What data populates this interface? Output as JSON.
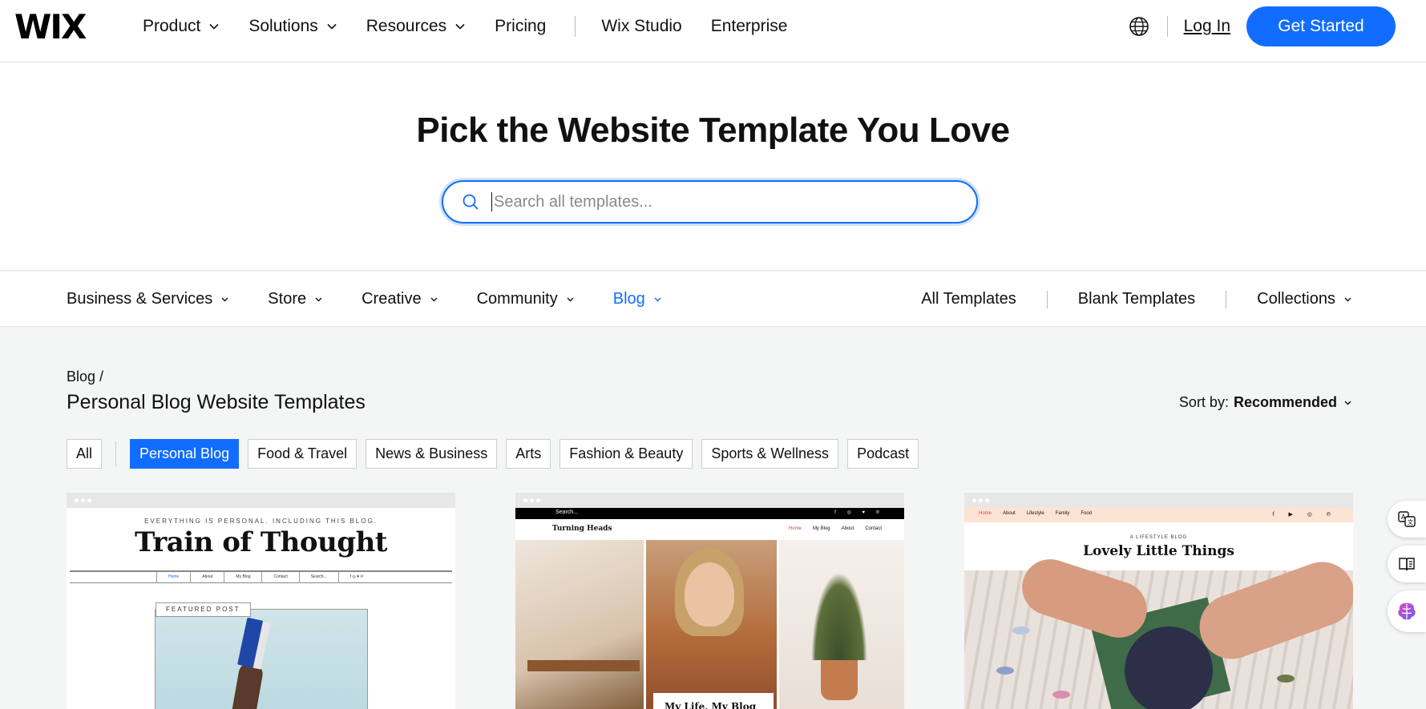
{
  "header": {
    "logo": "WIX",
    "nav": [
      {
        "label": "Product",
        "dropdown": true
      },
      {
        "label": "Solutions",
        "dropdown": true
      },
      {
        "label": "Resources",
        "dropdown": true
      },
      {
        "label": "Pricing",
        "dropdown": false
      }
    ],
    "nav_secondary": [
      {
        "label": "Wix Studio"
      },
      {
        "label": "Enterprise"
      }
    ],
    "login_label": "Log In",
    "cta_label": "Get Started",
    "globe_icon": "globe-icon"
  },
  "hero": {
    "title": "Pick the Website Template You Love",
    "search_placeholder": "Search all templates...",
    "search_value": ""
  },
  "categories": {
    "left": [
      {
        "label": "Business & Services",
        "active": false
      },
      {
        "label": "Store",
        "active": false
      },
      {
        "label": "Creative",
        "active": false
      },
      {
        "label": "Community",
        "active": false
      },
      {
        "label": "Blog",
        "active": true
      }
    ],
    "right": [
      {
        "label": "All Templates",
        "dropdown": false
      },
      {
        "label": "Blank Templates",
        "dropdown": false
      },
      {
        "label": "Collections",
        "dropdown": true
      }
    ]
  },
  "main": {
    "breadcrumb": "Blog /",
    "title": "Personal Blog Website Templates",
    "sort_label": "Sort by:",
    "sort_value": "Recommended",
    "filters": [
      {
        "label": "All",
        "active": false
      },
      {
        "label": "Personal Blog",
        "active": true
      },
      {
        "label": "Food & Travel",
        "active": false
      },
      {
        "label": "News & Business",
        "active": false
      },
      {
        "label": "Arts",
        "active": false
      },
      {
        "label": "Fashion & Beauty",
        "active": false
      },
      {
        "label": "Sports & Wellness",
        "active": false
      },
      {
        "label": "Podcast",
        "active": false
      }
    ]
  },
  "cards": {
    "card1": {
      "tagline": "EVERYTHING IS PERSONAL. INCLUDING THIS BLOG.",
      "title": "Train of Thought",
      "nav": [
        "Home",
        "About",
        "My Blog",
        "Contact",
        "Search..."
      ],
      "social": "f ◎ ♥ ℗",
      "featured": "FEATURED POST"
    },
    "card2": {
      "search": "Search...",
      "social": "f ◎ ♥ ℗",
      "brand": "Turning Heads",
      "nav": [
        "Home",
        "My Blog",
        "About",
        "Contact"
      ],
      "caption": "My Life, My Blog"
    },
    "card3": {
      "nav": [
        "Home",
        "About",
        "Lifestyle",
        "Family",
        "Food"
      ],
      "social": "f ▶ ◎ ℗",
      "tagline": "A LIFESTYLE BLOG",
      "title": "Lovely Little Things"
    }
  },
  "side_tools": [
    "translate-icon",
    "reader-icon",
    "ai-brain-icon"
  ],
  "colors": {
    "accent": "#116dff",
    "page_bg": "#f4f5f5"
  }
}
